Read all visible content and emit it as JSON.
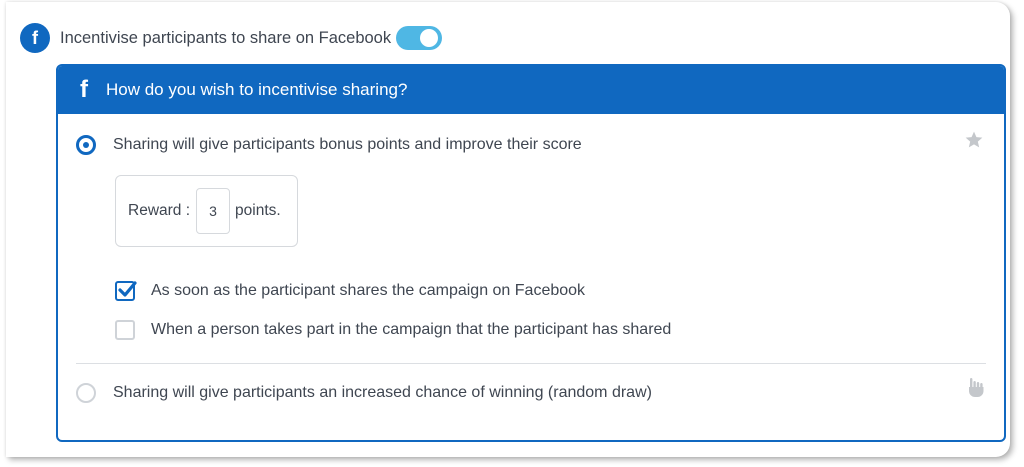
{
  "header": {
    "facebook_icon": "f",
    "label": "Incentivise participants to share on Facebook",
    "toggle_on": true
  },
  "panel": {
    "header_icon": "f",
    "title": "How do you wish to incentivise sharing?",
    "options": [
      {
        "label": "Sharing will give participants bonus points and improve their score",
        "selected": true,
        "side_icon": "star-icon"
      },
      {
        "label": "Sharing will give participants an increased chance of winning (random draw)",
        "selected": false,
        "side_icon": "hand-icon"
      }
    ],
    "reward": {
      "label": "Reward :",
      "value": "3",
      "unit": "points."
    },
    "checkboxes": [
      {
        "label": "As soon as the participant shares the campaign on Facebook",
        "checked": true
      },
      {
        "label": "When a person takes part in the campaign that the participant has shared",
        "checked": false
      }
    ]
  },
  "colors": {
    "brand_blue": "#1068c0",
    "toggle_blue": "#4fb7e4",
    "text": "#3f4651",
    "border": "#d6d9dd"
  }
}
